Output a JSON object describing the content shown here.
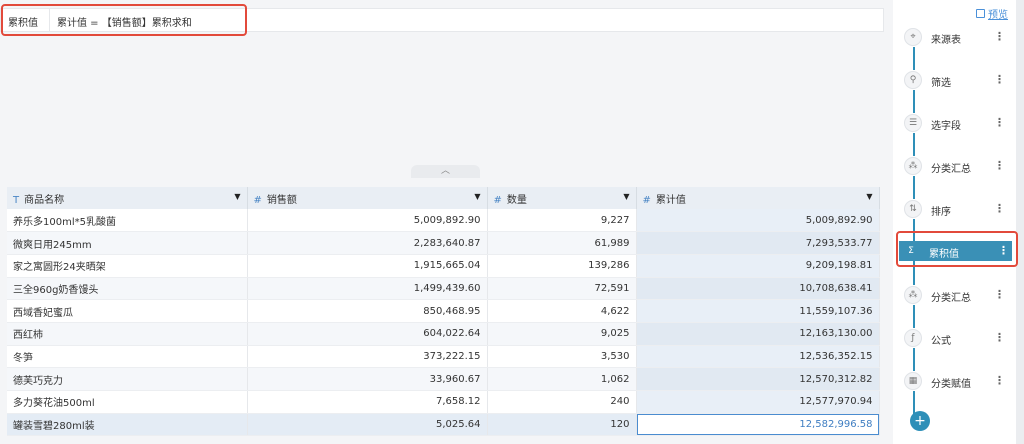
{
  "formula": {
    "label": "累积值",
    "text": "累计值 = 【销售额】累积求和"
  },
  "table": {
    "columns": [
      {
        "type_icon": "T",
        "label": "商品名称"
      },
      {
        "type_icon": "#",
        "label": "销售额"
      },
      {
        "type_icon": "#",
        "label": "数量"
      },
      {
        "type_icon": "#",
        "label": "累计值"
      }
    ],
    "rows": [
      {
        "name": "养乐多100ml*5乳酸菌",
        "sales": "5,009,892.90",
        "qty": "9,227",
        "cum": "5,009,892.90"
      },
      {
        "name": "微爽日用245mm",
        "sales": "2,283,640.87",
        "qty": "61,989",
        "cum": "7,293,533.77"
      },
      {
        "name": "家之寓圆形24夹晒架",
        "sales": "1,915,665.04",
        "qty": "139,286",
        "cum": "9,209,198.81"
      },
      {
        "name": "三全960g奶香馒头",
        "sales": "1,499,439.60",
        "qty": "72,591",
        "cum": "10,708,638.41"
      },
      {
        "name": "西域香妃蜜瓜",
        "sales": "850,468.95",
        "qty": "4,622",
        "cum": "11,559,107.36"
      },
      {
        "name": "西红柿",
        "sales": "604,022.64",
        "qty": "9,025",
        "cum": "12,163,130.00"
      },
      {
        "name": "冬笋",
        "sales": "373,222.15",
        "qty": "3,530",
        "cum": "12,536,352.15"
      },
      {
        "name": "德芙巧克力",
        "sales": "33,960.67",
        "qty": "1,062",
        "cum": "12,570,312.82"
      },
      {
        "name": "多力葵花油500ml",
        "sales": "7,658.12",
        "qty": "240",
        "cum": "12,577,970.94"
      },
      {
        "name": "罐装雪碧280ml装",
        "sales": "5,025.64",
        "qty": "120",
        "cum": "12,582,996.58"
      }
    ]
  },
  "panel": {
    "preview_label": "预览",
    "steps": [
      {
        "label": "来源表",
        "icon": "⌖"
      },
      {
        "label": "筛选",
        "icon": "⚲"
      },
      {
        "label": "选字段",
        "icon": "☰"
      },
      {
        "label": "分类汇总",
        "icon": "⁂"
      },
      {
        "label": "排序",
        "icon": "⇅"
      },
      {
        "label": "累积值",
        "icon": "Σ"
      },
      {
        "label": "分类汇总",
        "icon": "⁂"
      },
      {
        "label": "公式",
        "icon": "ƒ"
      },
      {
        "label": "分类赋值",
        "icon": "▦"
      }
    ],
    "more_glyph": "⋮",
    "add_glyph": "+"
  },
  "colors": {
    "accent": "#2e8fb8",
    "highlight": "#e24a3b",
    "link": "#4a90d9"
  }
}
